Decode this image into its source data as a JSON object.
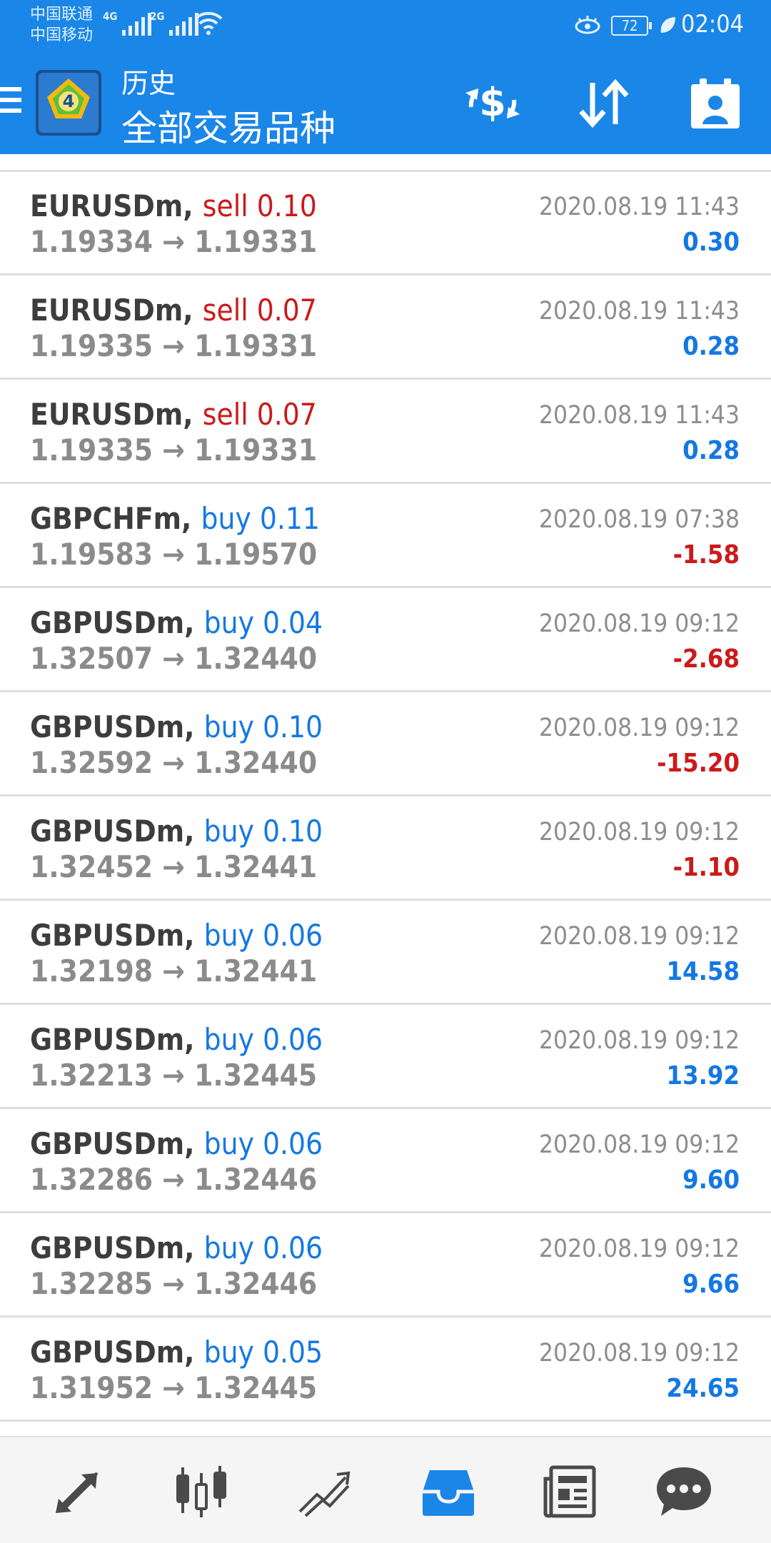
{
  "status_bar": {
    "carrier1": "中国联通",
    "carrier2": "中国移动",
    "signal1_label": "4G",
    "signal2_label": "2G",
    "battery": "72",
    "time": "02:04"
  },
  "header": {
    "title_small": "历史",
    "title_main": "全部交易品种",
    "icons": [
      "menu-icon",
      "metatrader4-logo",
      "currency-exchange-icon",
      "sort-icon",
      "account-icon"
    ],
    "accent": "#1a86e8"
  },
  "colors": {
    "buy": "#1478e3",
    "sell": "#cb1a1a",
    "profit": "#1478e3",
    "loss": "#cb1a1a"
  },
  "trades": [
    {
      "symbol": "EURUSDm,",
      "side": "sell 0.10",
      "side_type": "sell",
      "open": "1.19334",
      "close": "1.19331",
      "time": "2020.08.19 11:43",
      "pl": "0.30",
      "pl_type": "profit"
    },
    {
      "symbol": "EURUSDm,",
      "side": "sell 0.07",
      "side_type": "sell",
      "open": "1.19335",
      "close": "1.19331",
      "time": "2020.08.19 11:43",
      "pl": "0.28",
      "pl_type": "profit"
    },
    {
      "symbol": "EURUSDm,",
      "side": "sell 0.07",
      "side_type": "sell",
      "open": "1.19335",
      "close": "1.19331",
      "time": "2020.08.19 11:43",
      "pl": "0.28",
      "pl_type": "profit"
    },
    {
      "symbol": "GBPCHFm,",
      "side": "buy 0.11",
      "side_type": "buy",
      "open": "1.19583",
      "close": "1.19570",
      "time": "2020.08.19 07:38",
      "pl": "-1.58",
      "pl_type": "loss"
    },
    {
      "symbol": "GBPUSDm,",
      "side": "buy 0.04",
      "side_type": "buy",
      "open": "1.32507",
      "close": "1.32440",
      "time": "2020.08.19 09:12",
      "pl": "-2.68",
      "pl_type": "loss"
    },
    {
      "symbol": "GBPUSDm,",
      "side": "buy 0.10",
      "side_type": "buy",
      "open": "1.32592",
      "close": "1.32440",
      "time": "2020.08.19 09:12",
      "pl": "-15.20",
      "pl_type": "loss"
    },
    {
      "symbol": "GBPUSDm,",
      "side": "buy 0.10",
      "side_type": "buy",
      "open": "1.32452",
      "close": "1.32441",
      "time": "2020.08.19 09:12",
      "pl": "-1.10",
      "pl_type": "loss"
    },
    {
      "symbol": "GBPUSDm,",
      "side": "buy 0.06",
      "side_type": "buy",
      "open": "1.32198",
      "close": "1.32441",
      "time": "2020.08.19 09:12",
      "pl": "14.58",
      "pl_type": "profit"
    },
    {
      "symbol": "GBPUSDm,",
      "side": "buy 0.06",
      "side_type": "buy",
      "open": "1.32213",
      "close": "1.32445",
      "time": "2020.08.19 09:12",
      "pl": "13.92",
      "pl_type": "profit"
    },
    {
      "symbol": "GBPUSDm,",
      "side": "buy 0.06",
      "side_type": "buy",
      "open": "1.32286",
      "close": "1.32446",
      "time": "2020.08.19 09:12",
      "pl": "9.60",
      "pl_type": "profit"
    },
    {
      "symbol": "GBPUSDm,",
      "side": "buy 0.06",
      "side_type": "buy",
      "open": "1.32285",
      "close": "1.32446",
      "time": "2020.08.19 09:12",
      "pl": "9.66",
      "pl_type": "profit"
    },
    {
      "symbol": "GBPUSDm,",
      "side": "buy 0.05",
      "side_type": "buy",
      "open": "1.31952",
      "close": "1.32445",
      "time": "2020.08.19 09:12",
      "pl": "24.65",
      "pl_type": "profit"
    }
  ],
  "bottom_nav": {
    "items": [
      "quotes-icon",
      "chart-icon",
      "trade-icon",
      "history-icon",
      "news-icon",
      "chat-icon"
    ],
    "active": "history-icon",
    "active_color": "#1a86e8",
    "inactive_color": "#4a4a4a"
  }
}
